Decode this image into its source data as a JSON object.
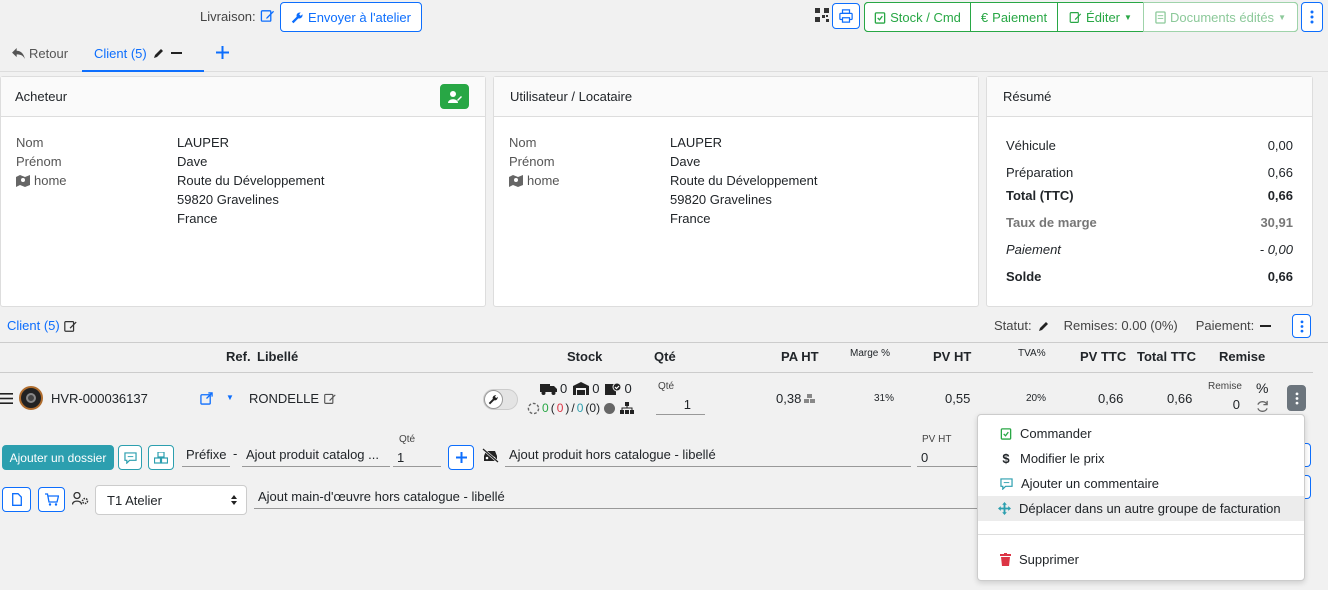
{
  "toolbar": {
    "livraison_label": "Livraison:",
    "envoyer_label": "Envoyer à l'atelier",
    "stock_cmd": "Stock / Cmd",
    "paiement": "Paiement",
    "editer": "Éditer",
    "documents_edites": "Documents édités"
  },
  "tabs": {
    "retour": "Retour",
    "client": "Client (5)"
  },
  "acheteur": {
    "title": "Acheteur",
    "nom_label": "Nom",
    "nom": "LAUPER",
    "prenom_label": "Prénom",
    "prenom": "Dave",
    "home_label": "home",
    "address1": "Route du Développement",
    "address2": "59820 Gravelines",
    "country": "France"
  },
  "utilisateur": {
    "title": "Utilisateur / Locataire",
    "nom_label": "Nom",
    "nom": "LAUPER",
    "prenom_label": "Prénom",
    "prenom": "Dave",
    "home_label": "home",
    "address1": "Route du Développement",
    "address2": "59820 Gravelines",
    "country": "France"
  },
  "resume": {
    "title": "Résumé",
    "rows": [
      {
        "label": "Véhicule",
        "value": "0,00"
      },
      {
        "label": "Préparation",
        "value": "0,66"
      },
      {
        "label": "Total (TTC)",
        "value": "0,66"
      },
      {
        "label": "Taux de marge",
        "value": "30,91"
      },
      {
        "label": "Paiement",
        "value": "- 0,00"
      },
      {
        "label": "Solde",
        "value": "0,66"
      }
    ]
  },
  "group": {
    "title": "Client (5)",
    "statut_label": "Statut:",
    "remises": "Remises: 0.00 (0%)",
    "paiement_label": "Paiement:"
  },
  "table": {
    "headers": {
      "ref": "Ref.",
      "libelle": "Libellé",
      "stock": "Stock",
      "qte": "Qté",
      "pa_ht": "PA HT",
      "marge": "Marge %",
      "pv_ht": "PV HT",
      "tva": "TVA%",
      "pv_ttc": "PV TTC",
      "total_ttc": "Total TTC",
      "remise": "Remise"
    },
    "row": {
      "ref": "HVR-000036137",
      "libelle": "RONDELLE",
      "stock_truck": "0",
      "stock_garage": "0",
      "stock_box": "0",
      "stock_b1": "0",
      "stock_b2": "0",
      "stock_b3": "0",
      "qte_label": "Qté",
      "qte": "1",
      "pa_ht": "0,38",
      "marge": "31%",
      "pv_ht": "0,55",
      "tva": "20%",
      "pv_ttc": "0,66",
      "total_ttc": "0,66",
      "remise_label": "Remise",
      "remise": "0",
      "percent": "%"
    }
  },
  "add_row": {
    "ajouter_dossier": "Ajouter un dossier",
    "prefixe": "Préfixe",
    "dash": "-",
    "catalog_placeholder": "Ajout produit catalog ...",
    "qte_label": "Qté",
    "qte": "1",
    "hors_catalogue": "Ajout produit hors catalogue - libellé",
    "pv_ht_label": "PV HT",
    "pv_ht": "0"
  },
  "mo_row": {
    "atelier_select": "T1 Atelier",
    "main_oeuvre": "Ajout main-d'œuvre hors catalogue - libellé"
  },
  "context_menu": {
    "items": [
      {
        "label": "Commander",
        "icon": "clipboard-check-icon"
      },
      {
        "label": "Modifier le prix",
        "icon": "dollar-icon"
      },
      {
        "label": "Ajouter un commentaire",
        "icon": "comment-icon"
      },
      {
        "label": "Déplacer dans un autre groupe de facturation",
        "icon": "move-icon"
      },
      {
        "label": "Supprimer",
        "icon": "trash-icon"
      }
    ]
  },
  "colors": {
    "primary": "#0d6efd",
    "green": "#28a745",
    "teal": "#2c9faf",
    "danger": "#dc3545"
  }
}
